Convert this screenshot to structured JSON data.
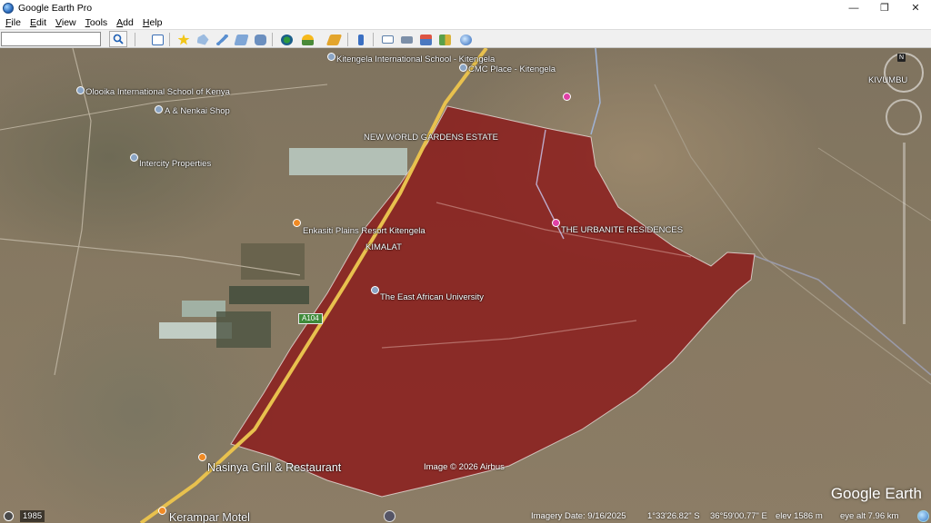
{
  "window": {
    "title": "Google Earth Pro",
    "controls": {
      "minimize": "—",
      "maximize": "❐",
      "close": "✕"
    }
  },
  "menu": [
    {
      "key": "F",
      "rest": "ile"
    },
    {
      "key": "E",
      "rest": "dit"
    },
    {
      "key": "V",
      "rest": "iew"
    },
    {
      "key": "T",
      "rest": "ools"
    },
    {
      "key": "A",
      "rest": "dd"
    },
    {
      "key": "H",
      "rest": "elp"
    }
  ],
  "search": {
    "value": "",
    "placeholder": ""
  },
  "toolbar_icons": [
    "sidebar-toggle-icon",
    "add-placemark-icon",
    "add-polygon-icon",
    "add-path-icon",
    "add-image-overlay-icon",
    "record-tour-icon",
    "historical-imagery-icon",
    "sunlight-icon",
    "planets-icon",
    "ruler-icon",
    "email-icon",
    "print-icon",
    "save-image-icon",
    "view-in-maps-icon",
    "sign-in-icon"
  ],
  "map": {
    "places": [
      {
        "name": "Kitengela International School - Kitengela",
        "pin": "grey"
      },
      {
        "name": "CMC Place - Kitengela",
        "pin": "grey"
      },
      {
        "name": "Olooika International School of Kenya",
        "pin": "grey"
      },
      {
        "name": "A & Nenkai Shop",
        "pin": "grey"
      },
      {
        "name": "NEW WORLD GARDENS ESTATE",
        "pin": ""
      },
      {
        "name": "Intercity Properties",
        "pin": "grey"
      },
      {
        "name": "Enkasiti Plains Resort Kitengela",
        "pin": "orange"
      },
      {
        "name": "THE URBANITE RESIDENCES",
        "pin": "pink"
      },
      {
        "name": "KIMALAT",
        "pin": ""
      },
      {
        "name": "The East African University",
        "pin": "grey"
      },
      {
        "name": "Nasinya Grill & Restaurant",
        "pin": "orange"
      },
      {
        "name": "Kerampar Motel",
        "pin": "orange"
      },
      {
        "name": "KIVUMBU",
        "pin": ""
      }
    ],
    "road_shield": "A104",
    "imagery_credit": "Image © 2026 Airbus",
    "watermark": "Google Earth",
    "compass_label": "N",
    "overlay_color": "#8b1a1a"
  },
  "status": {
    "history_year": "1985",
    "imagery_date": "Imagery Date: 9/16/2025",
    "latitude": "1°33'26.82\" S",
    "longitude": "36°59'00.77\" E",
    "elevation": "elev  1586 m",
    "eye_alt": "eye alt   7.96 km"
  }
}
